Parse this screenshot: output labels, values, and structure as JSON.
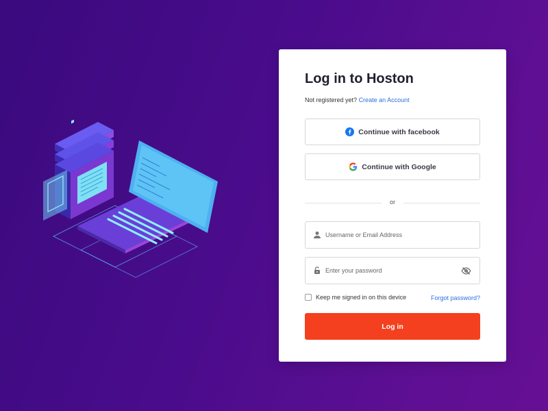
{
  "colors": {
    "background_start": "#3a0a7e",
    "background_end": "#650f94",
    "primary_button": "#f4401e",
    "link": "#2f6fe0",
    "facebook": "#1877f2"
  },
  "illustration": {
    "icon": "laptop-server-isometric-illustration"
  },
  "login": {
    "title": "Log in to Hoston",
    "not_registered": "Not registered yet?",
    "create_account": "Create an Account",
    "facebook_label": "Continue with facebook",
    "facebook_icon": "facebook-icon",
    "google_label": "Continue with Google",
    "google_icon": "google-icon",
    "divider_text": "or",
    "username_placeholder": "Username or Email Address",
    "username_icon": "user-icon",
    "password_placeholder": "Enter your password",
    "password_icon": "lock-icon",
    "toggle_icon": "eye-slash-icon",
    "keep_signed_in": "Keep me signed in on this device",
    "keep_signed_in_checked": false,
    "forgot_password": "Forgot password?",
    "login_button": "Log in"
  }
}
